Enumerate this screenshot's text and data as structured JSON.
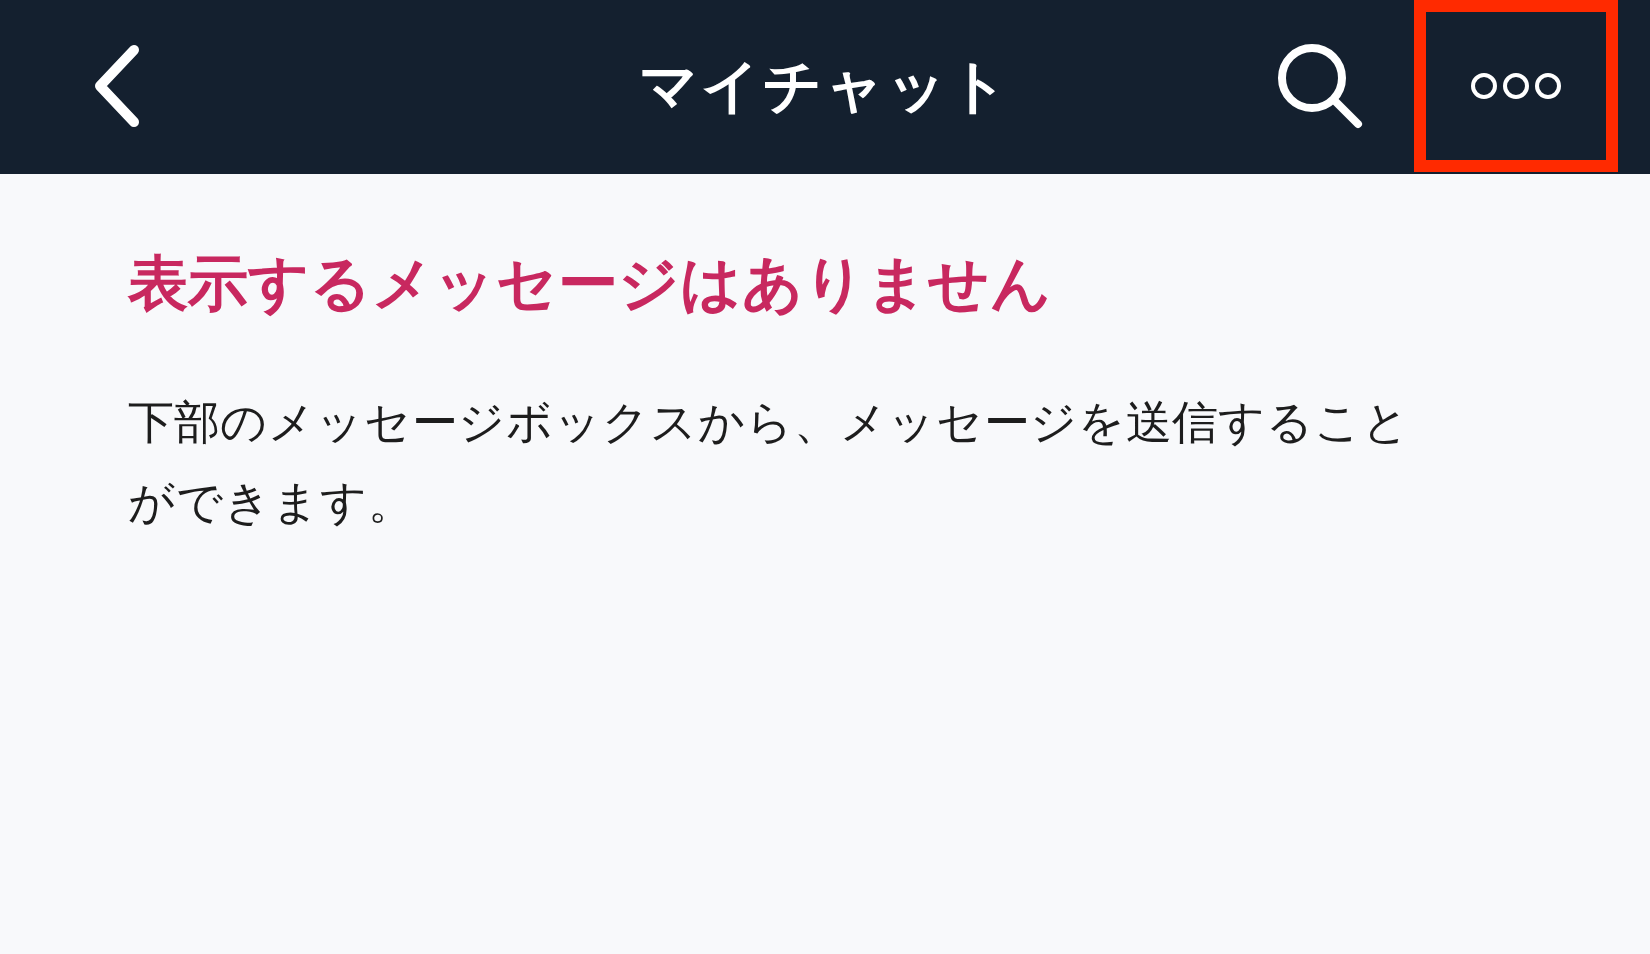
{
  "header": {
    "title": "マイチャット",
    "menu_button": {
      "highlighted": true
    }
  },
  "empty_state": {
    "heading": "表示するメッセージはありません",
    "message": "下部のメッセージボックスから、メッセージを送信することができます。"
  }
}
